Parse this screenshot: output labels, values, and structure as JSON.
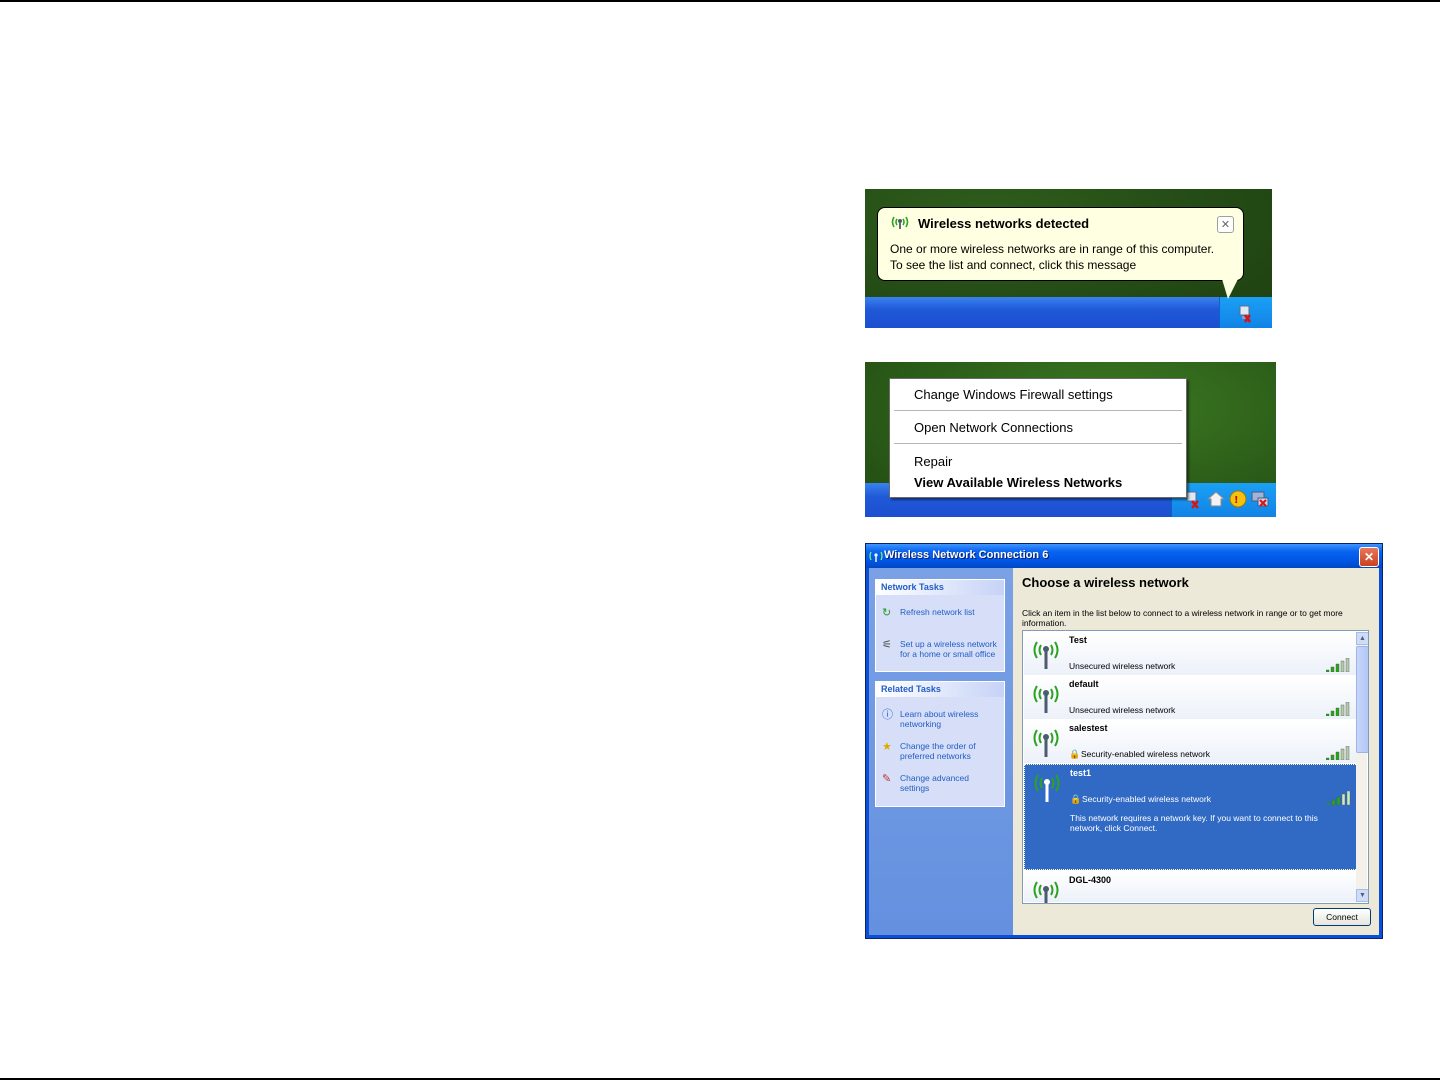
{
  "balloon": {
    "title": "Wireless networks detected",
    "line1": "One or more wireless networks are in range of this computer.",
    "line2": "To see the list and connect, click this message",
    "close_glyph": "✕"
  },
  "context_menu": {
    "items": [
      {
        "label": "Change Windows Firewall settings"
      },
      {
        "label": "Open Network Connections"
      },
      {
        "label": "Repair"
      },
      {
        "label": "View Available Wireless Networks"
      }
    ]
  },
  "dialog": {
    "title": "Wireless Network Connection 6",
    "close_glyph": "✕",
    "network_tasks": {
      "header": "Network Tasks",
      "items": [
        {
          "label": "Refresh network list",
          "icon": "refresh-icon"
        },
        {
          "label": "Set up a wireless network for a home or small office",
          "icon": "setup-wizard-icon"
        }
      ]
    },
    "related_tasks": {
      "header": "Related Tasks",
      "items": [
        {
          "label": "Learn about wireless networking",
          "icon": "info-icon"
        },
        {
          "label": "Change the order of preferred networks",
          "icon": "star-icon"
        },
        {
          "label": "Change advanced settings",
          "icon": "settings-icon"
        }
      ]
    },
    "heading": "Choose a wireless network",
    "description": "Click an item in the list below to connect to a wireless network in range or to get more information.",
    "networks": [
      {
        "name": "Test",
        "status": "Unsecured wireless network",
        "secured": false,
        "selected": false
      },
      {
        "name": "default",
        "status": "Unsecured wireless network",
        "secured": false,
        "selected": false
      },
      {
        "name": "salestest",
        "status": "Security-enabled wireless network",
        "secured": true,
        "selected": false
      },
      {
        "name": "test1",
        "status": "Security-enabled wireless network",
        "secured": true,
        "selected": true,
        "detail": "This network requires a network key. If you want to connect to this network, click Connect."
      },
      {
        "name": "DGL-4300",
        "status": "",
        "secured": false,
        "selected": false
      }
    ],
    "connect_button": "Connect"
  },
  "colors": {
    "xp_title_blue": "#0055e5",
    "selection_blue": "#316ac5",
    "link_blue": "#215dc6",
    "balloon_bg": "#ffffe1",
    "signal_green": "#2aa31f"
  }
}
